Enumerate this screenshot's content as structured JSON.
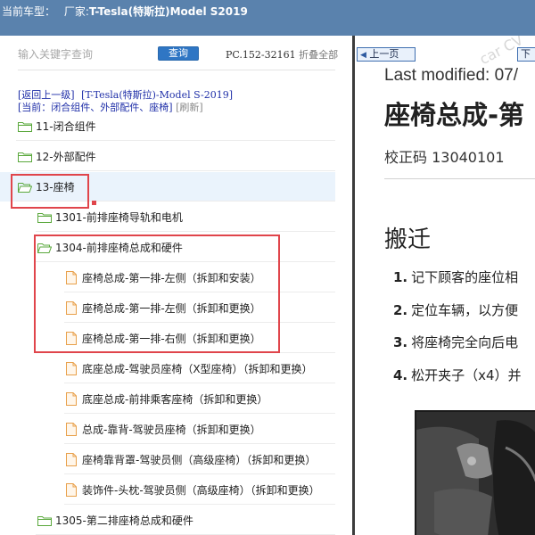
{
  "window": {
    "title_prefix": "当前车型：",
    "title_maker": "厂家:",
    "title_model": "T-Tesla(特斯拉)Model S2019"
  },
  "search": {
    "placeholder": "输入关键字查询",
    "button_label": "查询",
    "part_code": "PC.152-32161",
    "collapse_all": "折叠全部"
  },
  "nav": {
    "back_link": "[返回上一级]",
    "vehicle": "[T-Tesla(特斯拉)-Model S-2019]",
    "current_prefix": "[当前：",
    "current_path": "闭合组件、外部配件、座椅",
    "current_suffix": "]",
    "refresh": "[刷新]"
  },
  "tree": [
    {
      "type": "folder",
      "label": "11-闭合组件"
    },
    {
      "type": "folder",
      "label": "12-外部配件"
    },
    {
      "type": "folder",
      "label": "13-座椅",
      "selected": true
    },
    {
      "type": "folder",
      "label": "1301-前排座椅导轨和电机"
    },
    {
      "type": "folder",
      "label": "1304-前排座椅总成和硬件"
    },
    {
      "type": "file",
      "label": "座椅总成-第一排-左侧（拆卸和安装）"
    },
    {
      "type": "file",
      "label": "座椅总成-第一排-左侧（拆卸和更换）"
    },
    {
      "type": "file",
      "label": "座椅总成-第一排-右侧（拆卸和更换）"
    },
    {
      "type": "file",
      "label": "底座总成-驾驶员座椅（X型座椅）（拆卸和更换）"
    },
    {
      "type": "file",
      "label": "底座总成-前排乘客座椅（拆卸和更换）"
    },
    {
      "type": "file",
      "label": "总成-靠背-驾驶员座椅（拆卸和更换）"
    },
    {
      "type": "file",
      "label": "座椅靠背罩-驾驶员侧（高级座椅）（拆卸和更换）"
    },
    {
      "type": "file",
      "label": "装饰件-头枕-驾驶员侧（高级座椅）（拆卸和更换）"
    },
    {
      "type": "folder",
      "label": "1305-第二排座椅总成和硬件"
    }
  ],
  "doc": {
    "prev_label": "上一页",
    "next_label": "下",
    "watermark": "car CV",
    "last_modified": "Last modified: 07/",
    "title": "座椅总成-第",
    "check_code": "校正码 13040101",
    "section": "搬迁",
    "steps": [
      {
        "n": "1.",
        "text": "记下顾客的座位相"
      },
      {
        "n": "2.",
        "text": "定位车辆，以方便"
      },
      {
        "n": "3.",
        "text": "将座椅完全向后电"
      },
      {
        "n": "4.",
        "text": "松开夹子（x4）并"
      }
    ]
  },
  "colors": {
    "titlebar": "#5a82ad",
    "highlight_box": "#e0454b",
    "folder": "#5aa83c",
    "file": "#e8a04a",
    "link": "#1f2fa8"
  }
}
